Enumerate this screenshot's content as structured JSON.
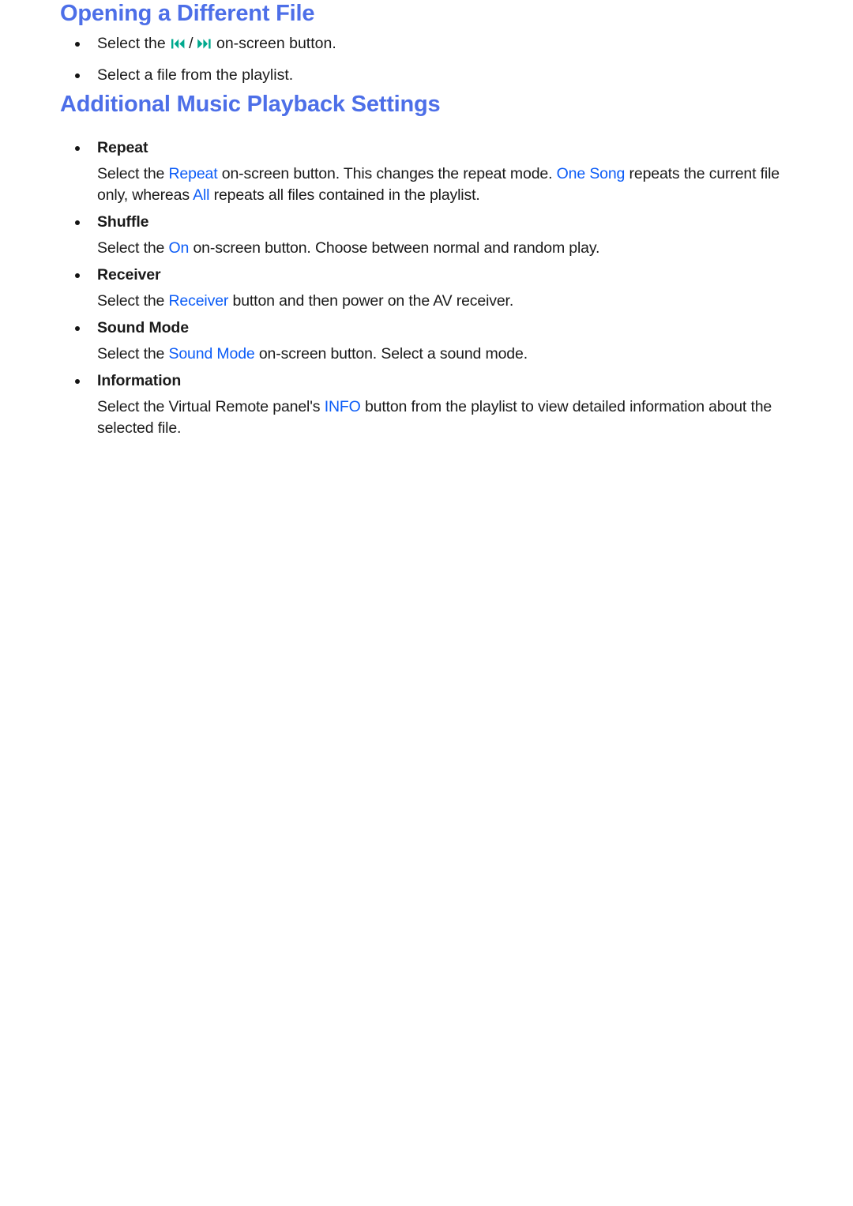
{
  "colors": {
    "heading_blue": "#4d6fe8",
    "inline_blue": "#0b5cf7",
    "icon_teal": "#00a98e",
    "body_text": "#1a1a1a",
    "background": "#ffffff"
  },
  "sections": [
    {
      "heading": "Opening a Different File",
      "bullets": [
        {
          "text_before_icons": "Select the ",
          "icon_prev": "previous-track-icon",
          "separator": " / ",
          "icon_next": "next-track-icon",
          "text_after_icons": " on-screen button."
        },
        {
          "text": "Select a file from the playlist."
        }
      ]
    },
    {
      "heading": "Additional Music Playback Settings",
      "items": [
        {
          "label": "Repeat",
          "body": {
            "part1": "Select the ",
            "term1": "Repeat",
            "part2": " on-screen button. This changes the repeat mode. ",
            "term2": "One Song",
            "part3": " repeats the current file only, whereas ",
            "term3": "All",
            "part4": " repeats all files contained in the playlist."
          }
        },
        {
          "label": "Shuffle",
          "body": {
            "part1": "Select the ",
            "term1": "On",
            "part2": " on-screen button. Choose between normal and random play."
          }
        },
        {
          "label": "Receiver",
          "body": {
            "part1": "Select the ",
            "term1": "Receiver",
            "part2": " button and then power on the AV receiver."
          }
        },
        {
          "label": "Sound Mode",
          "body": {
            "part1": "Select the ",
            "term1": "Sound Mode",
            "part2": " on-screen button. Select a sound mode."
          }
        },
        {
          "label": "Information",
          "body": {
            "part1": "Select the Virtual Remote panel's ",
            "term1": "INFO",
            "part2": " button from the playlist to view detailed information about the selected file."
          }
        }
      ]
    }
  ]
}
